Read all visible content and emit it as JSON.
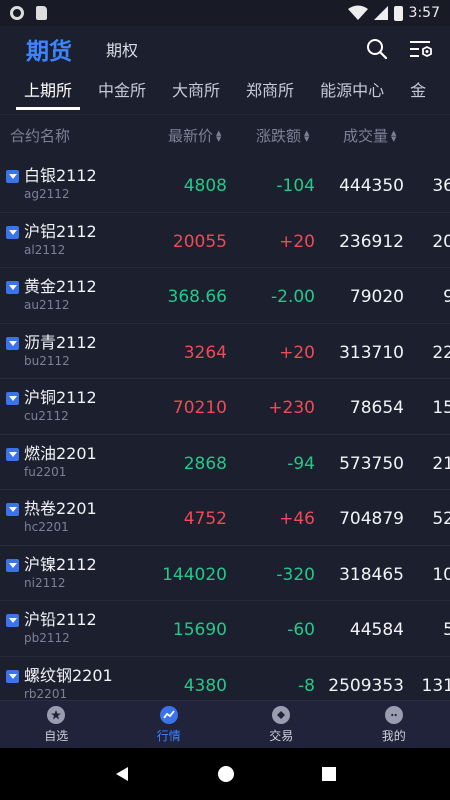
{
  "status_bar": {
    "time": "3:57"
  },
  "header": {
    "main_tab": "期货",
    "sub_tab": "期权"
  },
  "exchange_tabs": [
    "上期所",
    "中金所",
    "大商所",
    "郑商所",
    "能源中心",
    "金"
  ],
  "columns": {
    "name": "合约名称",
    "price": "最新价",
    "change": "涨跌额",
    "volume": "成交量"
  },
  "rows": [
    {
      "name": "白银2112",
      "code": "ag2112",
      "price": "4808",
      "change": "-104",
      "volume": "444350",
      "extra": "36",
      "dir": "down"
    },
    {
      "name": "沪铝2112",
      "code": "al2112",
      "price": "20055",
      "change": "+20",
      "volume": "236912",
      "extra": "20",
      "dir": "up"
    },
    {
      "name": "黄金2112",
      "code": "au2112",
      "price": "368.66",
      "change": "-2.00",
      "volume": "79020",
      "extra": "9",
      "dir": "down"
    },
    {
      "name": "沥青2112",
      "code": "bu2112",
      "price": "3264",
      "change": "+20",
      "volume": "313710",
      "extra": "22",
      "dir": "up"
    },
    {
      "name": "沪铜2112",
      "code": "cu2112",
      "price": "70210",
      "change": "+230",
      "volume": "78654",
      "extra": "15",
      "dir": "up"
    },
    {
      "name": "燃油2201",
      "code": "fu2201",
      "price": "2868",
      "change": "-94",
      "volume": "573750",
      "extra": "21",
      "dir": "down"
    },
    {
      "name": "热卷2201",
      "code": "hc2201",
      "price": "4752",
      "change": "+46",
      "volume": "704879",
      "extra": "52",
      "dir": "up"
    },
    {
      "name": "沪镍2112",
      "code": "ni2112",
      "price": "144020",
      "change": "-320",
      "volume": "318465",
      "extra": "10",
      "dir": "down"
    },
    {
      "name": "沪铅2112",
      "code": "pb2112",
      "price": "15690",
      "change": "-60",
      "volume": "44584",
      "extra": "5",
      "dir": "down"
    },
    {
      "name": "螺纹钢2201",
      "code": "rb2201",
      "price": "4380",
      "change": "-8",
      "volume": "2509353",
      "extra": "131",
      "dir": "down"
    }
  ],
  "bottom_nav": [
    {
      "label": "自选",
      "icon": "star-icon"
    },
    {
      "label": "行情",
      "icon": "chart-icon",
      "active": true
    },
    {
      "label": "交易",
      "icon": "trade-icon"
    },
    {
      "label": "我的",
      "icon": "profile-icon"
    }
  ],
  "colors": {
    "up": "#f04a57",
    "down": "#22c98a",
    "accent": "#3b86ff",
    "background": "#1c1f2e"
  }
}
